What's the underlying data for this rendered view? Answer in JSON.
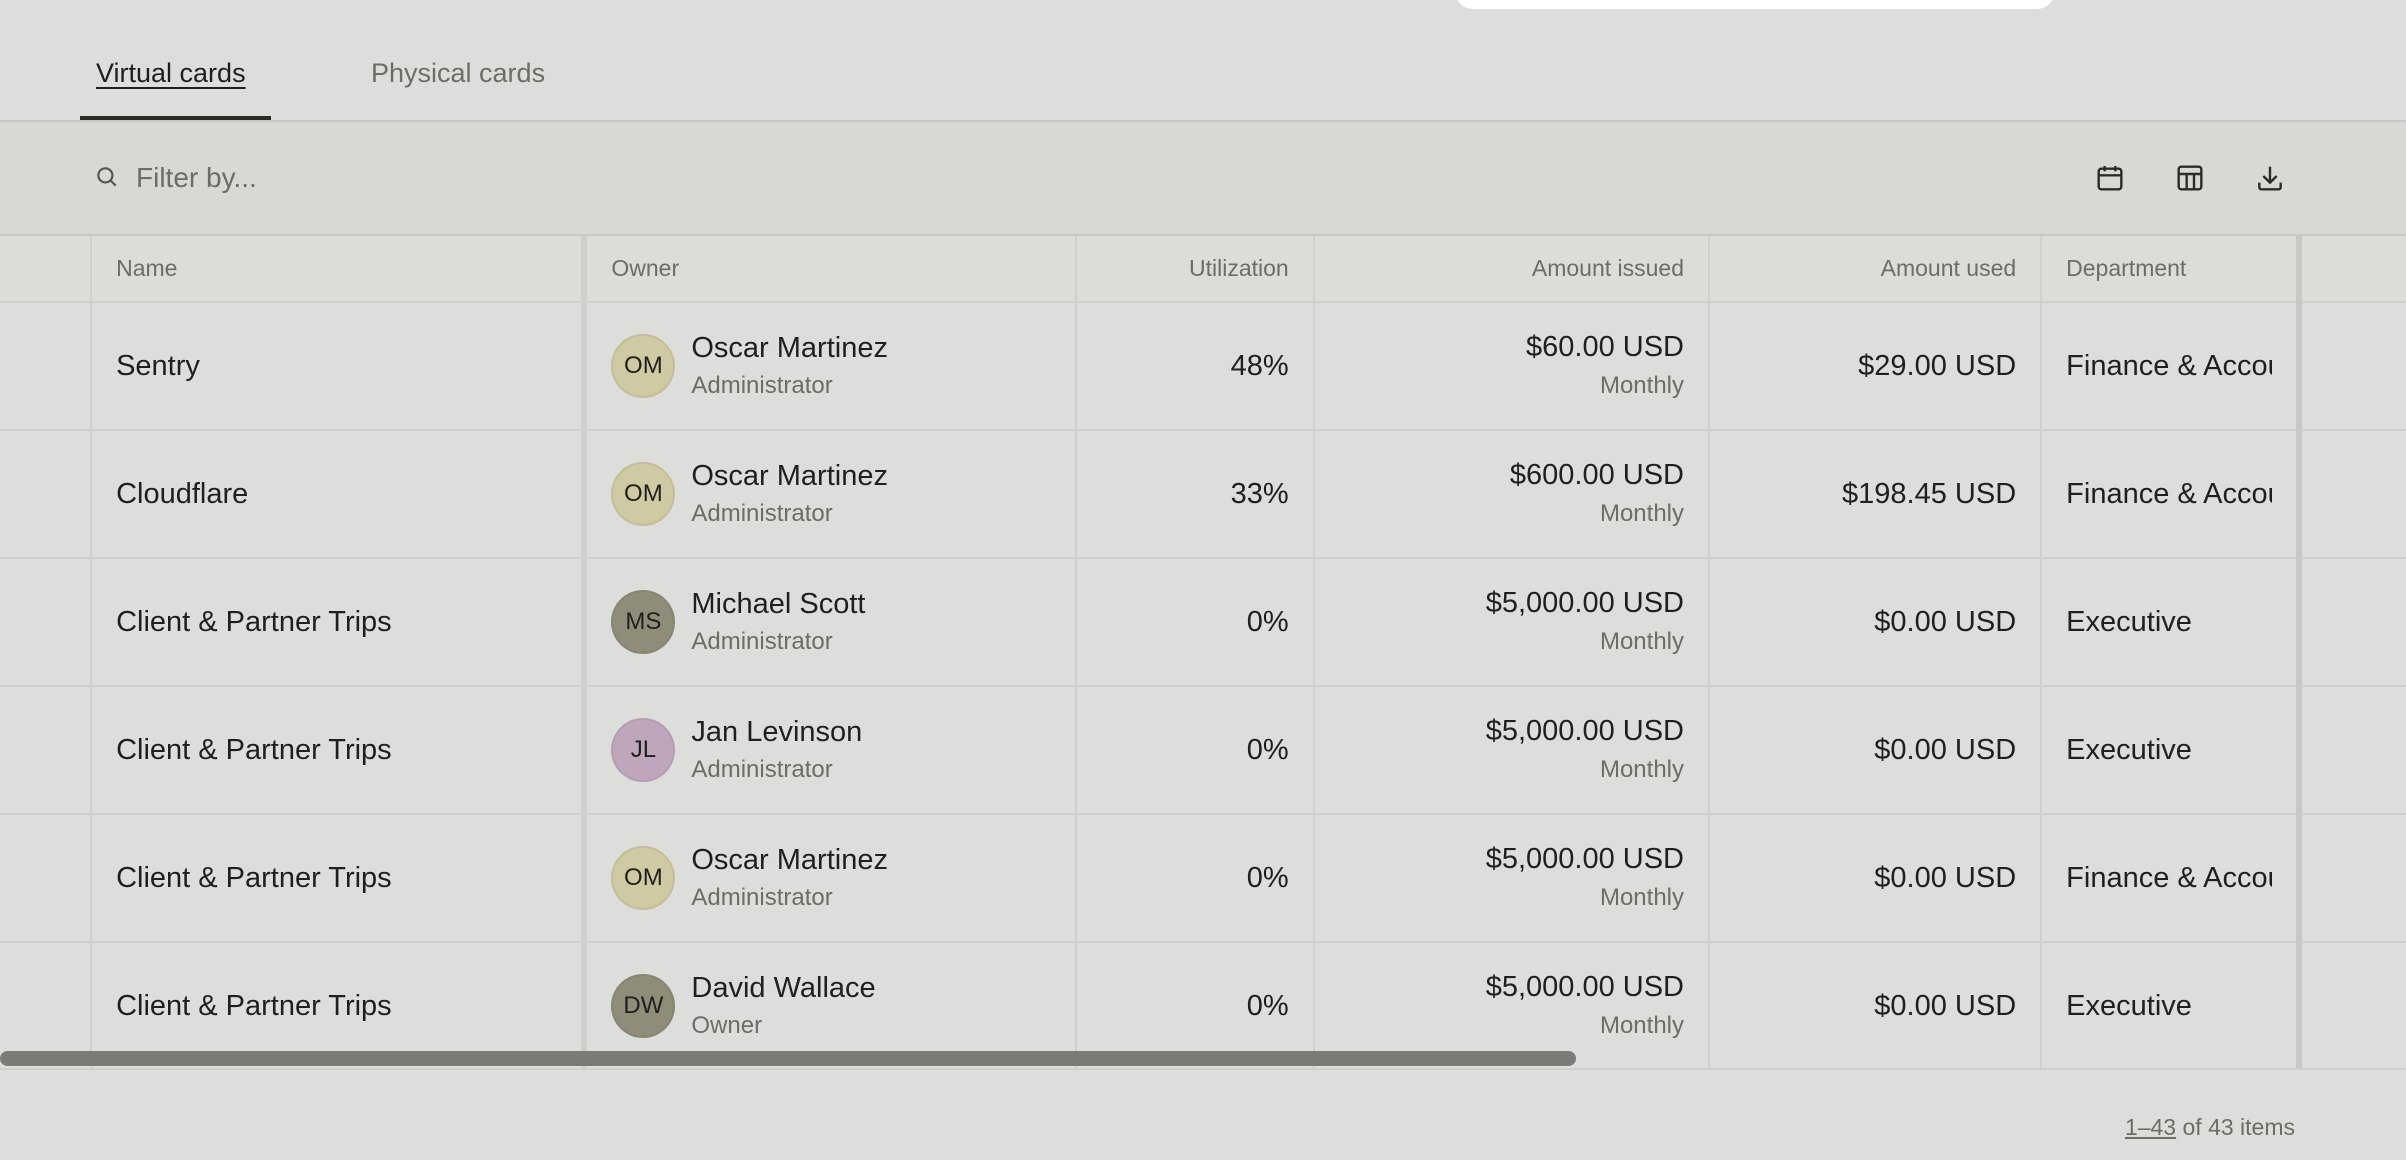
{
  "tabs": [
    {
      "label": "Virtual cards",
      "active": true
    },
    {
      "label": "Physical cards",
      "active": false
    }
  ],
  "toolbar": {
    "search_placeholder": "Filter by...",
    "icons": [
      "search-icon",
      "calendar-icon",
      "columns-icon",
      "download-icon"
    ]
  },
  "table": {
    "headers": {
      "name": "Name",
      "owner": "Owner",
      "utilization": "Utilization",
      "amount_issued": "Amount issued",
      "amount_used": "Amount used",
      "department": "Department"
    },
    "rows": [
      {
        "name": "Sentry",
        "initials": "OM",
        "avatar_color": "#cfc9a4",
        "owner": "Oscar Martinez",
        "role": "Administrator",
        "utilization": "48%",
        "issued": "$60.00 USD",
        "period": "Monthly",
        "used": "$29.00 USD",
        "department": "Finance & Accounting"
      },
      {
        "name": "Cloudflare",
        "initials": "OM",
        "avatar_color": "#cfc9a4",
        "owner": "Oscar Martinez",
        "role": "Administrator",
        "utilization": "33%",
        "issued": "$600.00 USD",
        "period": "Monthly",
        "used": "$198.45 USD",
        "department": "Finance & Accounting"
      },
      {
        "name": "Client & Partner Trips",
        "initials": "MS",
        "avatar_color": "#8f8d7a",
        "owner": "Michael Scott",
        "role": "Administrator",
        "utilization": "0%",
        "issued": "$5,000.00 USD",
        "period": "Monthly",
        "used": "$0.00 USD",
        "department": "Executive"
      },
      {
        "name": "Client & Partner Trips",
        "initials": "JL",
        "avatar_color": "#c0a6bd",
        "owner": "Jan Levinson",
        "role": "Administrator",
        "utilization": "0%",
        "issued": "$5,000.00 USD",
        "period": "Monthly",
        "used": "$0.00 USD",
        "department": "Executive"
      },
      {
        "name": "Client & Partner Trips",
        "initials": "OM",
        "avatar_color": "#cfc9a4",
        "owner": "Oscar Martinez",
        "role": "Administrator",
        "utilization": "0%",
        "issued": "$5,000.00 USD",
        "period": "Monthly",
        "used": "$0.00 USD",
        "department": "Finance & Accounting"
      },
      {
        "name": "Client & Partner Trips",
        "initials": "DW",
        "avatar_color": "#8f8d7a",
        "owner": "David Wallace",
        "role": "Owner",
        "utilization": "0%",
        "issued": "$5,000.00 USD",
        "period": "Monthly",
        "used": "$0.00 USD",
        "department": "Executive"
      }
    ]
  },
  "pagination": {
    "range": "1–43",
    "suffix": " of 43 items"
  }
}
